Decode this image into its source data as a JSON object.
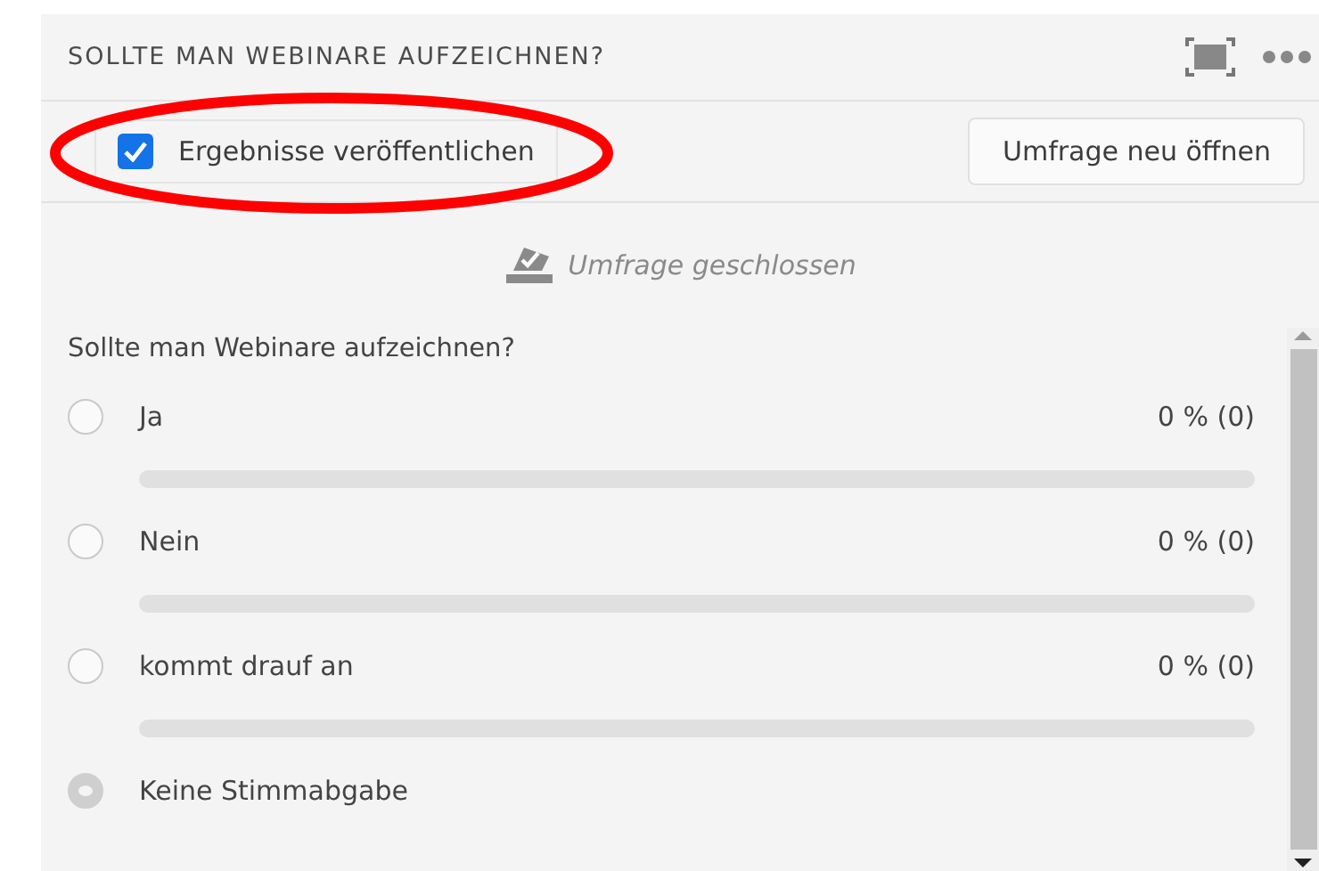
{
  "panel": {
    "title": "SOLLTE MAN WEBINARE AUFZEICHNEN?"
  },
  "publish_results": {
    "label": "Ergebnisse veröffentlichen",
    "checked": true,
    "highlighted": true
  },
  "reopen_button": {
    "label": "Umfrage neu öffnen"
  },
  "status": {
    "text": "Umfrage geschlossen"
  },
  "question": "Sollte man Webinare aufzeichnen?",
  "options": [
    {
      "kind": "answer",
      "label": "Ja",
      "reading": "0 % (0)",
      "selected": false,
      "level": 0
    },
    {
      "kind": "answer",
      "label": "Nein",
      "reading": "0 % (0)",
      "selected": false,
      "level": 0
    },
    {
      "kind": "answer",
      "label": "kommt drauf an",
      "reading": "0 % (0)",
      "selected": false,
      "level": 0
    },
    {
      "kind": "abstain",
      "label": "Keine Stimmabgabe",
      "selected": true
    }
  ]
}
